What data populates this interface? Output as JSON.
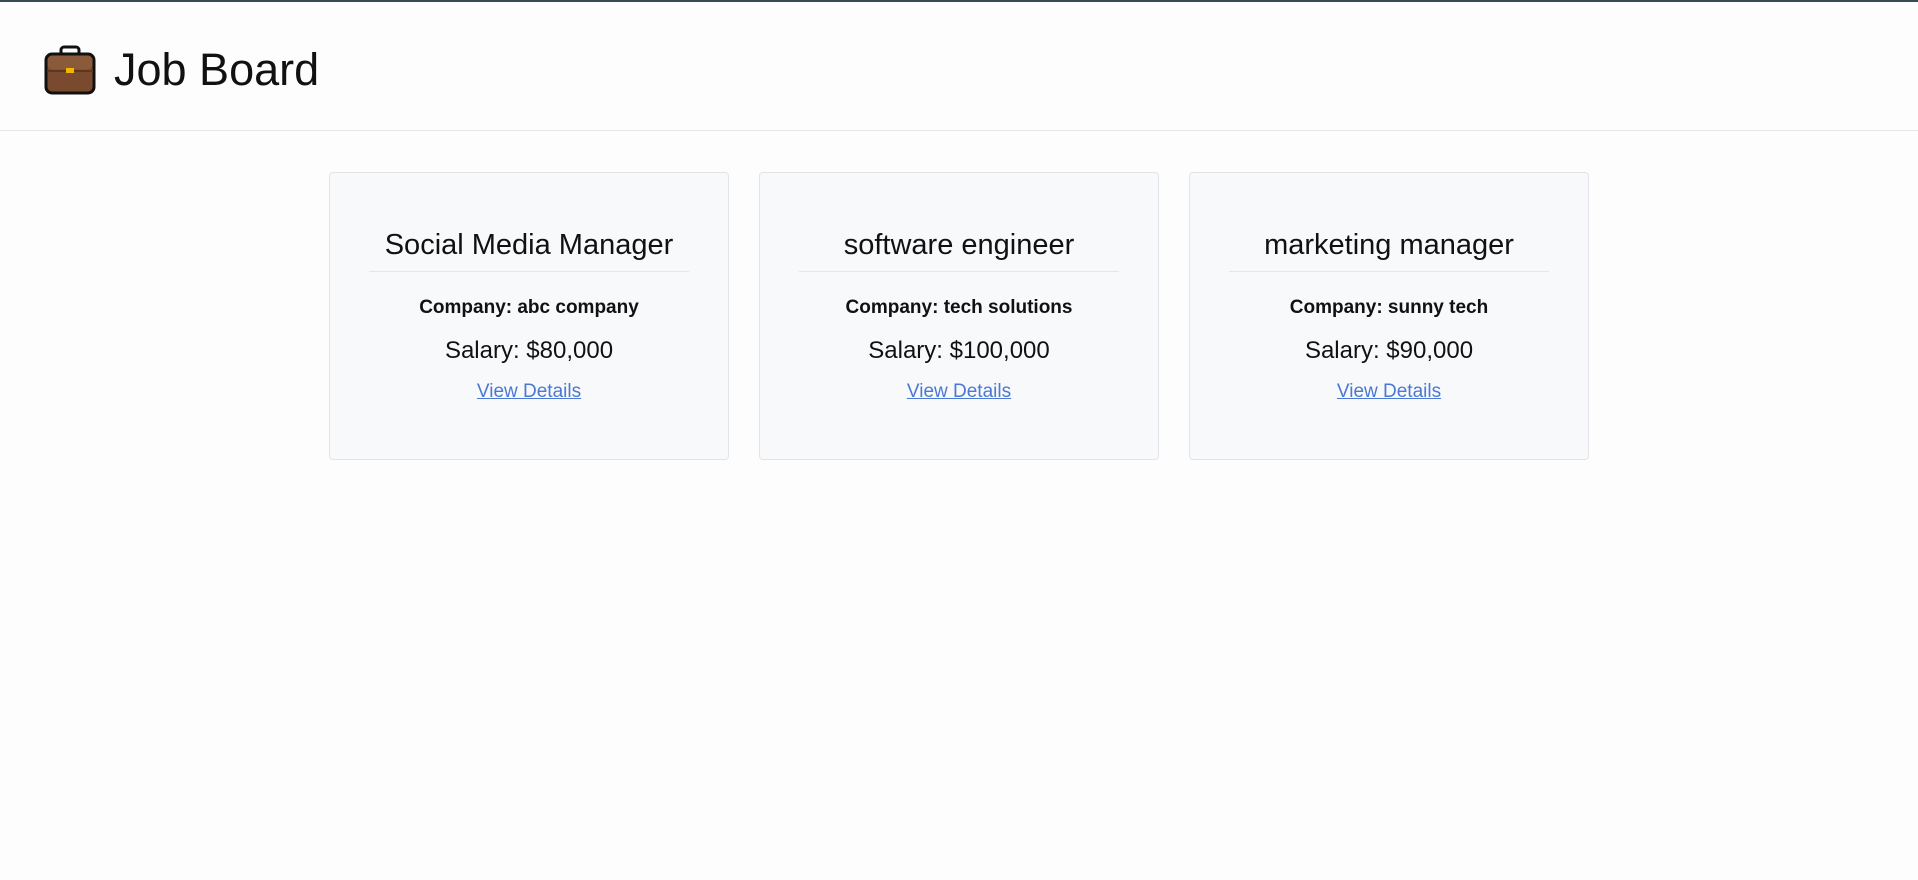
{
  "header": {
    "title": "Job Board",
    "icon": "briefcase-icon"
  },
  "jobs": [
    {
      "title": "Social Media Manager",
      "company": "Company: abc company",
      "salary": "Salary: $80,000",
      "link_label": "View Details"
    },
    {
      "title": "software engineer",
      "company": "Company: tech solutions",
      "salary": "Salary: $100,000",
      "link_label": "View Details"
    },
    {
      "title": "marketing manager",
      "company": "Company: sunny tech",
      "salary": "Salary: $90,000",
      "link_label": "View Details"
    }
  ],
  "colors": {
    "link": "#4a78d4",
    "card_background": "#f8f9fa",
    "briefcase": "#7a4a2e"
  }
}
